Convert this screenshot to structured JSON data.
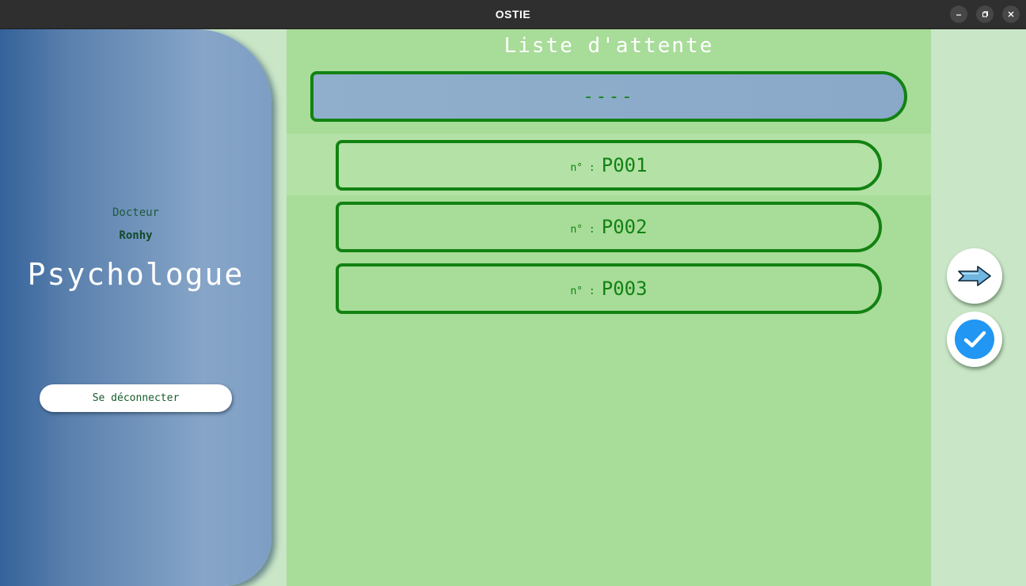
{
  "window": {
    "title": "OSTIE",
    "controls": {
      "minimize_icon": "minimize-icon",
      "maximize_icon": "restore-icon",
      "close_icon": "close-icon"
    }
  },
  "profile": {
    "title_label": "Docteur",
    "name": "Ronhy",
    "specialty": "Psychologue",
    "logout_label": "Se déconnecter"
  },
  "queue": {
    "title": "Liste d'attente",
    "current_patient": "----",
    "number_prefix": "n° :",
    "patients": [
      {
        "id": "P001",
        "highlighted": true
      },
      {
        "id": "P002",
        "highlighted": false
      },
      {
        "id": "P003",
        "highlighted": false
      }
    ]
  },
  "actions": {
    "next_icon": "arrow-right-icon",
    "validate_icon": "checkmark-icon"
  },
  "colors": {
    "titlebar": "#2f2f2f",
    "background": "#c9e6c7",
    "main_panel": "#a8dc99",
    "accent_green": "#128212",
    "profile_blue": "#5a80ad",
    "validate_blue": "#2196f3"
  }
}
